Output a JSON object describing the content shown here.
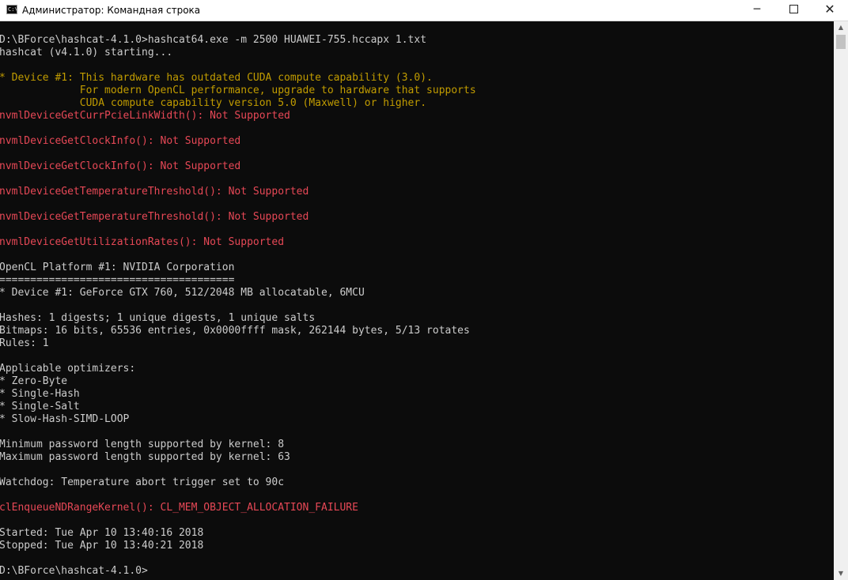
{
  "window": {
    "title": "Администратор: Командная строка",
    "icon_text": "C:\\",
    "minimize": "─",
    "close": "✕"
  },
  "colors": {
    "default": "#cccccc",
    "warning": "#c19c00",
    "error": "#e74856",
    "background": "#0c0c0c"
  },
  "console": {
    "lines": [
      {
        "text": "D:\\BForce\\hashcat-4.1.0>hashcat64.exe -m 2500 HUAWEI-755.hccapx 1.txt",
        "color": "w"
      },
      {
        "text": "hashcat (v4.1.0) starting...",
        "color": "w"
      },
      {
        "text": "",
        "color": "w"
      },
      {
        "text": "* Device #1: This hardware has outdated CUDA compute capability (3.0).",
        "color": "y"
      },
      {
        "text": "             For modern OpenCL performance, upgrade to hardware that supports",
        "color": "y"
      },
      {
        "text": "             CUDA compute capability version 5.0 (Maxwell) or higher.",
        "color": "y"
      },
      {
        "text": "nvmlDeviceGetCurrPcieLinkWidth(): Not Supported",
        "color": "r"
      },
      {
        "text": "",
        "color": "w"
      },
      {
        "text": "nvmlDeviceGetClockInfo(): Not Supported",
        "color": "r"
      },
      {
        "text": "",
        "color": "w"
      },
      {
        "text": "nvmlDeviceGetClockInfo(): Not Supported",
        "color": "r"
      },
      {
        "text": "",
        "color": "w"
      },
      {
        "text": "nvmlDeviceGetTemperatureThreshold(): Not Supported",
        "color": "r"
      },
      {
        "text": "",
        "color": "w"
      },
      {
        "text": "nvmlDeviceGetTemperatureThreshold(): Not Supported",
        "color": "r"
      },
      {
        "text": "",
        "color": "w"
      },
      {
        "text": "nvmlDeviceGetUtilizationRates(): Not Supported",
        "color": "r"
      },
      {
        "text": "",
        "color": "w"
      },
      {
        "text": "OpenCL Platform #1: NVIDIA Corporation",
        "color": "w"
      },
      {
        "text": "======================================",
        "color": "w"
      },
      {
        "text": "* Device #1: GeForce GTX 760, 512/2048 MB allocatable, 6MCU",
        "color": "w"
      },
      {
        "text": "",
        "color": "w"
      },
      {
        "text": "Hashes: 1 digests; 1 unique digests, 1 unique salts",
        "color": "w"
      },
      {
        "text": "Bitmaps: 16 bits, 65536 entries, 0x0000ffff mask, 262144 bytes, 5/13 rotates",
        "color": "w"
      },
      {
        "text": "Rules: 1",
        "color": "w"
      },
      {
        "text": "",
        "color": "w"
      },
      {
        "text": "Applicable optimizers:",
        "color": "w"
      },
      {
        "text": "* Zero-Byte",
        "color": "w"
      },
      {
        "text": "* Single-Hash",
        "color": "w"
      },
      {
        "text": "* Single-Salt",
        "color": "w"
      },
      {
        "text": "* Slow-Hash-SIMD-LOOP",
        "color": "w"
      },
      {
        "text": "",
        "color": "w"
      },
      {
        "text": "Minimum password length supported by kernel: 8",
        "color": "w"
      },
      {
        "text": "Maximum password length supported by kernel: 63",
        "color": "w"
      },
      {
        "text": "",
        "color": "w"
      },
      {
        "text": "Watchdog: Temperature abort trigger set to 90c",
        "color": "w"
      },
      {
        "text": "",
        "color": "w"
      },
      {
        "text": "clEnqueueNDRangeKernel(): CL_MEM_OBJECT_ALLOCATION_FAILURE",
        "color": "r"
      },
      {
        "text": "",
        "color": "w"
      },
      {
        "text": "Started: Tue Apr 10 13:40:16 2018",
        "color": "w"
      },
      {
        "text": "Stopped: Tue Apr 10 13:40:21 2018",
        "color": "w"
      },
      {
        "text": "",
        "color": "w"
      },
      {
        "text": "D:\\BForce\\hashcat-4.1.0>",
        "color": "w"
      }
    ]
  },
  "scrollbar": {
    "up_arrow": "▲",
    "down_arrow": "▼"
  }
}
